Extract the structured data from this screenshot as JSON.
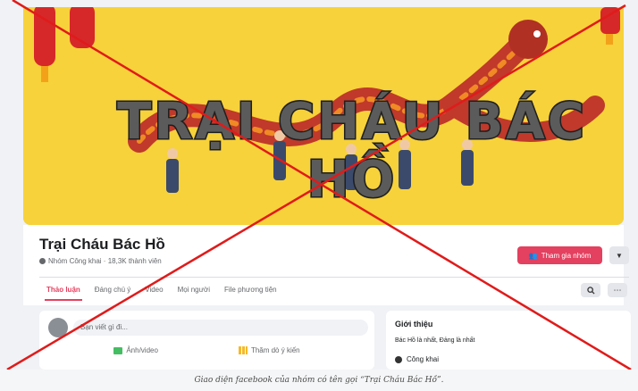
{
  "cover": {
    "title_text": "TRẠI CHÁU BÁC HỒ",
    "colors": {
      "background": "#f7d23a",
      "dragon": "#c0392b",
      "text_fill": "#5b5b5b"
    }
  },
  "group": {
    "name": "Trại Cháu Bác Hồ",
    "meta": "Nhóm Công khai · 18,3K thành viên",
    "join_label": "Tham gia nhóm",
    "join_color": "#e4405f"
  },
  "tabs": [
    {
      "label": "Thảo luận",
      "active": true
    },
    {
      "label": "Đáng chú ý",
      "active": false
    },
    {
      "label": "Video",
      "active": false
    },
    {
      "label": "Mọi người",
      "active": false
    },
    {
      "label": "File phương tiện",
      "active": false
    }
  ],
  "icons": {
    "search": "search-icon",
    "more": "more-horizontal-icon",
    "dropdown": "chevron-down-icon",
    "globe": "globe-icon",
    "photo": "photo-icon",
    "poll": "poll-icon"
  },
  "composer": {
    "placeholder": "Bạn viết gì đi...",
    "photo_label": "Ảnh/video",
    "poll_label": "Thăm dò ý kiến"
  },
  "about": {
    "title": "Giới thiệu",
    "description": "Bác Hồ là nhất, Đảng là nhất",
    "privacy": "Công khai"
  },
  "overlay": {
    "color": "#e01b1b"
  },
  "caption": "Giao diện facebook của nhóm có tên gọi “Trại Cháu Bác Hồ”."
}
